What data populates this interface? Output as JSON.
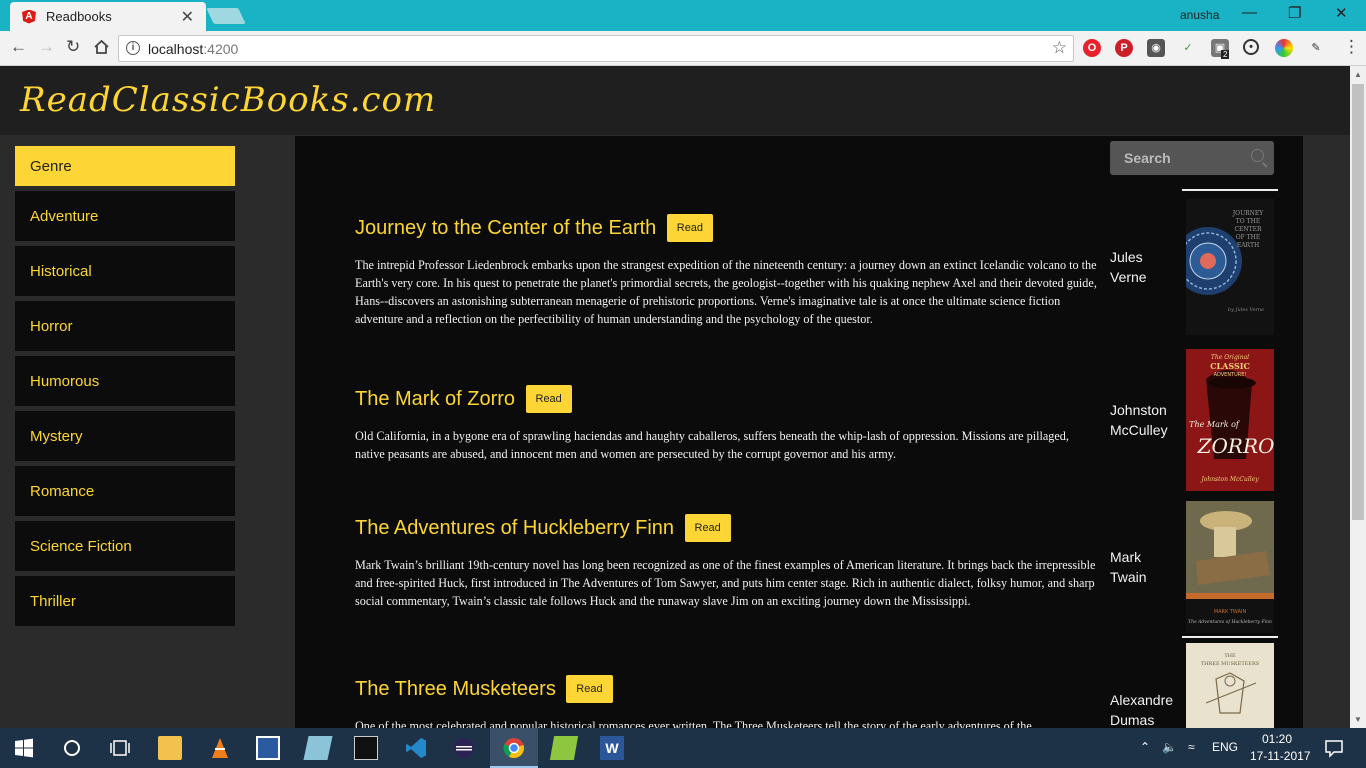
{
  "browser": {
    "tab_title": "Readbooks",
    "tab_close": "✕",
    "user_name": "anusha",
    "minimize": "—",
    "maximize": "❐",
    "close": "✕",
    "url_host": "localhost",
    "url_port": ":4200",
    "extension_badge": "2"
  },
  "site": {
    "logo": "ReadClassicBooks.com"
  },
  "sidebar": {
    "items": [
      {
        "label": "Genre",
        "active": true
      },
      {
        "label": "Adventure"
      },
      {
        "label": "Historical"
      },
      {
        "label": "Horror"
      },
      {
        "label": "Humorous"
      },
      {
        "label": "Mystery"
      },
      {
        "label": "Romance"
      },
      {
        "label": "Science Fiction"
      },
      {
        "label": "Thriller"
      }
    ]
  },
  "search": {
    "placeholder": "Search"
  },
  "read_label": "Read",
  "books": [
    {
      "title": "Journey to the Center of the Earth",
      "description": "The intrepid Professor Liedenbrock embarks upon the strangest expedition of the nineteenth century: a journey down an extinct Icelandic volcano to the Earth's very core. In his quest to penetrate the planet's primordial secrets, the geologist--together with his quaking nephew Axel and their devoted guide, Hans--discovers an astonishing subterranean menagerie of prehistoric proportions. Verne's imaginative tale is at once the ultimate science fiction adventure and a reflection on the perfectibility of human understanding and the psychology of the questor.",
      "author_first": "Jules",
      "author_last": "Verne",
      "cover_text": "JOURNEY TO THE CENTER OF THE EARTH",
      "cover_byline": "by Jules Verne"
    },
    {
      "title": "The Mark of Zorro",
      "description": "Old California, in a bygone era of sprawling haciendas and haughty caballeros, suffers beneath the whip-lash of oppression. Missions are pillaged, native peasants are abused, and innocent men and women are persecuted by the corrupt governor and his army.",
      "author_first": "Johnston",
      "author_last": "McCulley",
      "cover_top": "The Original CLASSIC ADVENTURE!",
      "cover_text": "The Mark of ZORRO",
      "cover_byline": "Johnston McCulley"
    },
    {
      "title": "The Adventures of Huckleberry Finn",
      "description": "Mark Twain’s brilliant 19th-century novel has long been recognized as one of the finest examples of American literature. It brings back the irrepressible and free-spirited Huck, first introduced in The Adventures of Tom Sawyer, and puts him center stage. Rich in authentic dialect, folksy humor, and sharp social commentary, Twain’s classic tale follows Huck and the runaway slave Jim on an exciting journey down the Mississippi.",
      "author_first": "Mark",
      "author_last": "Twain",
      "cover_author": "MARK TWAIN",
      "cover_text": "The Adventures of Huckleberry Finn"
    },
    {
      "title": "The Three Musketeers",
      "description": "One of the most celebrated and popular historical romances ever written, The Three Musketeers tell the story of the early adventures of the",
      "author_first": "Alexandre",
      "author_last": "Dumas",
      "cover_text": "THE THREE MUSKETEERS"
    }
  ],
  "taskbar": {
    "time": "01:20",
    "date": "17-11-2017",
    "language": "ENG"
  }
}
